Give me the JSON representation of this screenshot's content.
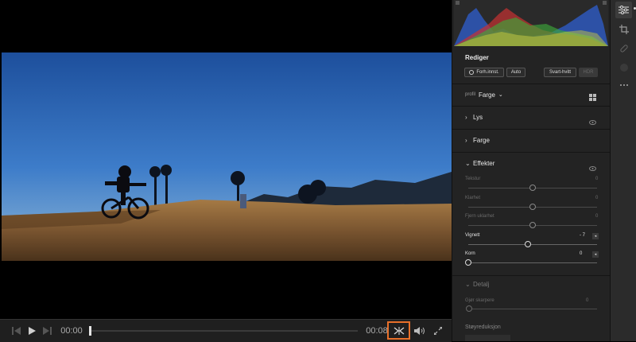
{
  "player": {
    "current_time": "00:00",
    "duration": "00:08",
    "controls": [
      "previous-frame-icon",
      "play-icon",
      "next-frame-icon",
      "trim-icon",
      "volume-icon",
      "fullscreen-icon"
    ],
    "trim_highlight_color": "#e8702a"
  },
  "panel": {
    "title": "Rediger",
    "buttons": {
      "presets": "Forh.innst.",
      "auto": "Auto",
      "bw": "Svart-hvitt",
      "hdr": "HDR"
    },
    "profile_label": "profil",
    "profile_value": "Farge",
    "sections": {
      "light": "Lys",
      "color": "Farge",
      "effects": "Effekter",
      "detail": "Detalj"
    },
    "effects": [
      {
        "label": "Tekstur",
        "value": "0",
        "level": 0.5,
        "active": false
      },
      {
        "label": "Klarhet",
        "value": "0",
        "level": 0.5,
        "active": false
      },
      {
        "label": "Fjern uklarhet",
        "value": "0",
        "level": 0.5,
        "active": false
      },
      {
        "label": "Vignett",
        "value": "- 7",
        "level": 0.46,
        "active": true
      },
      {
        "label": "Korn",
        "value": "0",
        "level": 0.0,
        "active": true
      }
    ],
    "detail": {
      "sharpen_label": "Gjør skarpere",
      "sharpen_value": "0",
      "noise_label": "Støyreduksjon"
    }
  },
  "toolbar": {
    "icons": [
      "edit-sliders-icon",
      "crop-icon",
      "healing-icon",
      "masking-icon",
      "more-icon"
    ]
  },
  "colors": {
    "accent": "#e8702a",
    "panel_bg": "#232323",
    "sky": "#2f66b8"
  }
}
